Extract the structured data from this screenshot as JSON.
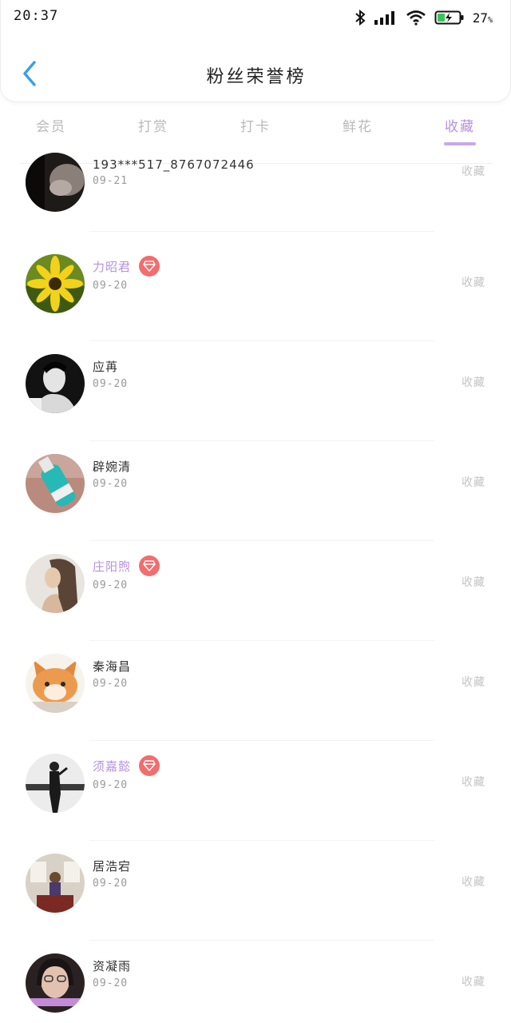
{
  "status_bar": {
    "time": "20:37",
    "battery_percent": "27",
    "battery_unit": "%",
    "icons": [
      "bluetooth-icon",
      "cellular-signal-icon",
      "wifi-icon",
      "battery-charging-icon"
    ]
  },
  "header": {
    "title": "粉丝荣誉榜",
    "back_icon": "chevron-left-icon"
  },
  "tabs": [
    {
      "label": "会员",
      "active": false
    },
    {
      "label": "打赏",
      "active": false
    },
    {
      "label": "打卡",
      "active": false
    },
    {
      "label": "鲜花",
      "active": false
    },
    {
      "label": "收藏",
      "active": true
    }
  ],
  "colors": {
    "accent": "#b592dd",
    "back_icon": "#3a9ee8",
    "vip_badge": "#f26d6d",
    "muted": "#c4c4c4"
  },
  "list": [
    {
      "name": "193***517_8767072446",
      "date": "09-21",
      "vip": false,
      "action": "收藏",
      "avatar": "dark-photo"
    },
    {
      "name": "力昭君",
      "date": "09-20",
      "vip": true,
      "action": "收藏",
      "avatar": "yellow-flower"
    },
    {
      "name": "应苒",
      "date": "09-20",
      "vip": false,
      "action": "收藏",
      "avatar": "bw-portrait"
    },
    {
      "name": "辟婉清",
      "date": "09-20",
      "vip": false,
      "action": "收藏",
      "avatar": "teal-bottle"
    },
    {
      "name": "庄阳煦",
      "date": "09-20",
      "vip": true,
      "action": "收藏",
      "avatar": "illustrated-person"
    },
    {
      "name": "秦海昌",
      "date": "09-20",
      "vip": false,
      "action": "收藏",
      "avatar": "orange-cat"
    },
    {
      "name": "须嘉懿",
      "date": "09-20",
      "vip": true,
      "action": "收藏",
      "avatar": "standing-figure"
    },
    {
      "name": "居浩宕",
      "date": "09-20",
      "vip": false,
      "action": "收藏",
      "avatar": "room-scene"
    },
    {
      "name": "资凝雨",
      "date": "09-20",
      "vip": false,
      "action": "收藏",
      "avatar": "girl-glasses"
    }
  ]
}
